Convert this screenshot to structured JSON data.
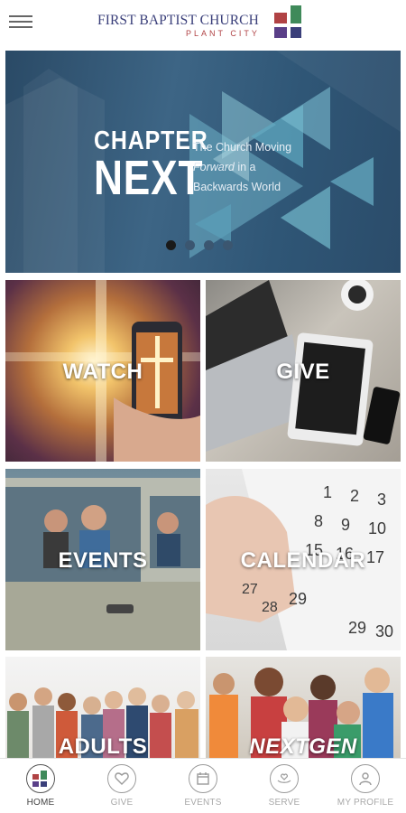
{
  "header": {
    "logo_title": "FIRST BAPTIST CHURCH",
    "logo_subtitle": "PLANT CITY",
    "menu_icon": "hamburger-menu-icon"
  },
  "hero": {
    "title_line1": "CHAPTER",
    "title_line2": "NEXT",
    "tagline_1": "The Church Moving",
    "tagline_2_em": "Forward",
    "tagline_2_rest": " in a",
    "tagline_3": "Backwards World",
    "active_slide": 1,
    "slide_count": 4
  },
  "tiles": [
    {
      "label": "WATCH"
    },
    {
      "label": "GIVE"
    },
    {
      "label": "EVENTS"
    },
    {
      "label": "CALENDAR"
    },
    {
      "label": "ADULTS"
    },
    {
      "label": "NEXTGEN"
    }
  ],
  "bottom_nav": [
    {
      "label": "HOME",
      "icon": "church-logo-icon",
      "active": true
    },
    {
      "label": "GIVE",
      "icon": "heart-icon",
      "active": false
    },
    {
      "label": "EVENTS",
      "icon": "calendar-icon",
      "active": false
    },
    {
      "label": "SERVE",
      "icon": "hands-heart-icon",
      "active": false
    },
    {
      "label": "MY PROFILE",
      "icon": "person-icon",
      "active": false
    }
  ],
  "colors": {
    "brand_navy": "#3a3f7a",
    "brand_red": "#b04244",
    "logo_green": "#3f8a5a",
    "logo_purple": "#5a3f88",
    "hero_blue": "#3d6585",
    "triangle_teal": "#6fb3c8"
  }
}
